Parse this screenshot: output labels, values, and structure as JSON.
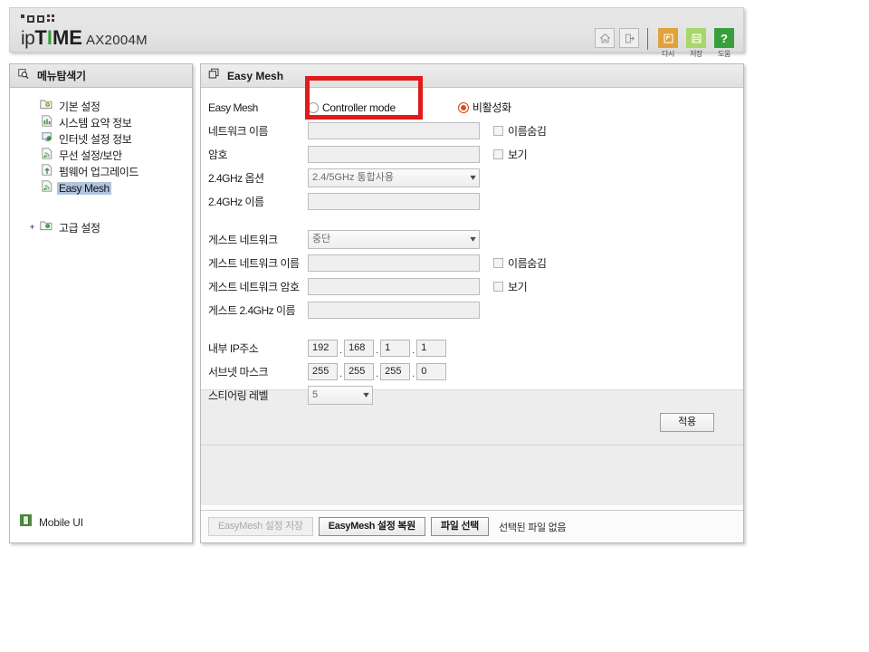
{
  "header": {
    "brand_ip": "ip",
    "brand_t": "T",
    "brand_i": "I",
    "brand_me": "ME",
    "model": "AX2004M",
    "icons": [
      {
        "name": "home-icon",
        "glyph": "⌂"
      },
      {
        "name": "logout-icon",
        "glyph": "↪"
      }
    ],
    "color_buttons": [
      {
        "name": "restart-button",
        "glyph": "↵",
        "label": "다시",
        "color": "#e0a33c"
      },
      {
        "name": "save-button",
        "glyph": "💾",
        "label": "저장",
        "color": "#a7d66a"
      },
      {
        "name": "help-button",
        "glyph": "?",
        "label": "도움",
        "color": "#37a03c"
      }
    ]
  },
  "sidebar": {
    "title": "메뉴탐색기",
    "groups": [
      {
        "label": "기본 설정",
        "expander": "",
        "items": [
          {
            "label": "시스템 요약 정보",
            "selected": false
          },
          {
            "label": "인터넷 설정 정보",
            "selected": false
          },
          {
            "label": "무선 설정/보안",
            "selected": false
          },
          {
            "label": "펌웨어 업그레이드",
            "selected": false
          },
          {
            "label": "Easy Mesh",
            "selected": true
          }
        ]
      },
      {
        "label": "고급 설정",
        "expander": "+",
        "items": []
      }
    ],
    "footer_label": "Mobile UI"
  },
  "main": {
    "panel_title": "Easy Mesh",
    "rows": {
      "easy_mesh_label": "Easy Mesh",
      "mode_controller": "Controller mode",
      "mode_disabled": "비활성화",
      "network_name_label": "네트워크 이름",
      "network_name_value": "",
      "hide_name_label": "이름숨김",
      "password_label": "암호",
      "password_value": "",
      "show_label": "보기",
      "ghz24_option_label": "2.4GHz 옵션",
      "ghz24_option_value": "2.4/5GHz 통합사용",
      "ghz24_name_label": "2.4GHz 이름",
      "ghz24_name_value": "",
      "guest_network_label": "게스트 네트워크",
      "guest_network_value": "중단",
      "guest_name_label": "게스트 네트워크 이름",
      "guest_name_value": "",
      "guest_hide_name_label": "이름숨김",
      "guest_password_label": "게스트 네트워크 암호",
      "guest_password_value": "",
      "guest_show_label": "보기",
      "guest_24_name_label": "게스트 2.4GHz 이름",
      "guest_24_name_value": "",
      "internal_ip_label": "내부 IP주소",
      "internal_ip": [
        "192",
        "168",
        "1",
        "1"
      ],
      "subnet_mask_label": "서브넷 마스크",
      "subnet_mask": [
        "255",
        "255",
        "255",
        "0"
      ],
      "steering_level_label": "스티어링 레벨",
      "steering_level_value": "5"
    },
    "apply_button": "적용",
    "footer": {
      "save_config_button": "EasyMesh 설정 저장",
      "restore_config_button": "EasyMesh 설정 복원",
      "file_select_button": "파일 선택",
      "file_status": "선택된 파일 없음"
    }
  },
  "annotation": {
    "color": "#e01b1b"
  }
}
